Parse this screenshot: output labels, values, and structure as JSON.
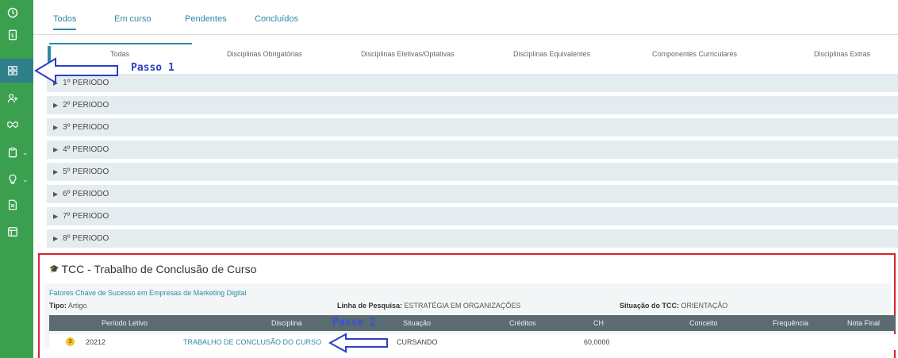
{
  "sidebar": {
    "items": [
      {
        "icon": "clock-icon"
      },
      {
        "icon": "document-dollar-icon"
      },
      {
        "icon": "grid-icon"
      },
      {
        "icon": "user-add-icon"
      },
      {
        "icon": "handshake-icon"
      },
      {
        "icon": "clipboard-icon",
        "chevron": "⌄"
      },
      {
        "icon": "lightbulb-icon",
        "chevron": "⌄"
      },
      {
        "icon": "file-text-icon"
      },
      {
        "icon": "layout-icon"
      }
    ],
    "active_index": 2
  },
  "top_tabs": [
    "Todos",
    "Em curso",
    "Pendentes",
    "Concluídos"
  ],
  "sub_tabs": [
    "Todas",
    "Disciplinas Obrigatórias",
    "Disciplinas Eletivas/Optativas",
    "Disciplinas Equivalentes",
    "Componentes Curriculares",
    "Disciplinas Extras"
  ],
  "periods": [
    "1º PERIODO",
    "2º PERIODO",
    "3º PERIODO",
    "4º PERIODO",
    "5º PERIODO",
    "6º PERIODO",
    "7º PERIODO",
    "8º PERIODO"
  ],
  "tcc": {
    "header": "TCC - Trabalho de Conclusão de Curso",
    "title": "Fatores Chave de Sucesso em Empresas de Marketing Digital",
    "tipo_label": "Tipo:",
    "tipo_value": "Artigo",
    "linha_label": "Linha de Pesquisa:",
    "linha_value": "ESTRATÉGIA EM ORGANIZAÇÕES",
    "situacao_label": "Situação do TCC:",
    "situacao_value": "ORIENTAÇÃO",
    "columns": [
      "Período Letivo",
      "Disciplina",
      "Situação",
      "Créditos",
      "CH",
      "Conceito",
      "Frequência",
      "Nota Final"
    ],
    "row": {
      "badge": "3",
      "periodo": "20212",
      "disciplina": "TRABALHO DE CONCLUSÃO DO CURSO",
      "situacao": "CURSANDO",
      "ch": "60,0000"
    }
  },
  "annotations": {
    "passo1": "Passo 1",
    "passo2": "Passo 2"
  },
  "colors": {
    "sidebar": "#3aa04f",
    "accent": "#2e8aa3",
    "highlight_border": "#d9232d",
    "annotation": "#2d3fc6"
  }
}
